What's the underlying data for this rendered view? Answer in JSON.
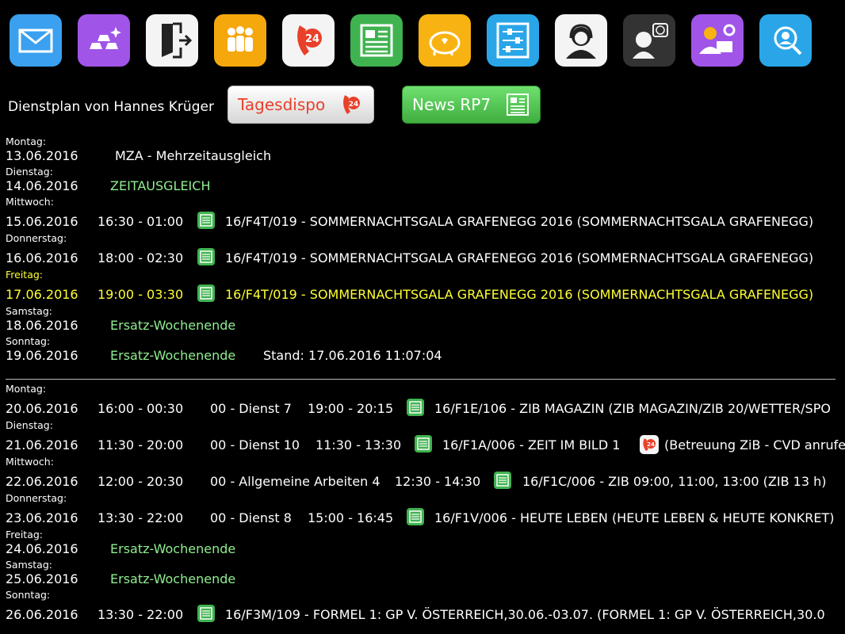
{
  "header": {
    "title": "Dienstplan von Hannes Krüger"
  },
  "buttons": {
    "tagesdispo": "Tagesdispo",
    "news": "News RP7"
  },
  "apps": [
    "mail-icon",
    "gold-bars-icon",
    "door-exit-icon",
    "people-group-icon",
    "phone-24-icon",
    "newspaper-icon",
    "piggy-bank-icon",
    "settings-sliders-icon",
    "support-headset-icon",
    "user-world-icon",
    "worker-laptop-icon",
    "user-search-icon"
  ],
  "week1": {
    "d0": {
      "weekday": "Montag:",
      "date": "13.06.2016",
      "text": "MZA - Mehrzeitausgleich"
    },
    "d1": {
      "weekday": "Dienstag:",
      "date": "14.06.2016",
      "text": "ZEITAUSGLEICH"
    },
    "d2": {
      "weekday": "Mittwoch:",
      "date": "15.06.2016",
      "time": "16:30 - 01:00",
      "text": "16/F4T/019 - SOMMERNACHTSGALA GRAFENEGG 2016 (SOMMERNACHTSGALA GRAFENEGG)"
    },
    "d3": {
      "weekday": "Donnerstag:",
      "date": "16.06.2016",
      "time": "18:00 - 02:30",
      "text": "16/F4T/019 - SOMMERNACHTSGALA GRAFENEGG 2016 (SOMMERNACHTSGALA GRAFENEGG)"
    },
    "d4": {
      "weekday": "Freitag:",
      "date": "17.06.2016",
      "time": "19:00 - 03:30",
      "text": "16/F4T/019 - SOMMERNACHTSGALA GRAFENEGG 2016 (SOMMERNACHTSGALA GRAFENEGG)"
    },
    "d5": {
      "weekday": "Samstag:",
      "date": "18.06.2016",
      "text": "Ersatz-Wochenende"
    },
    "d6": {
      "weekday": "Sonntag:",
      "date": "19.06.2016",
      "text": "Ersatz-Wochenende",
      "stand": "Stand: 17.06.2016 11:07:04"
    }
  },
  "week2": {
    "d0": {
      "weekday": "Montag:",
      "date": "20.06.2016",
      "time": "16:00 - 00:30",
      "duty": "00 - Dienst 7",
      "slot": "19:00 - 20:15",
      "text": "16/F1E/106 - ZIB MAGAZIN (ZIB MAGAZIN/ZIB 20/WETTER/SPO"
    },
    "d1": {
      "weekday": "Dienstag:",
      "date": "21.06.2016",
      "time": "11:30 - 20:00",
      "duty": "00 - Dienst 10",
      "slot": "11:30 - 13:30",
      "text": "16/F1A/006 - ZEIT IM BILD 1",
      "extra": "(Betreuung ZiB - CVD anrufen"
    },
    "d2": {
      "weekday": "Mittwoch:",
      "date": "22.06.2016",
      "time": "12:00 - 20:30",
      "duty": "00 - Allgemeine Arbeiten 4",
      "slot": "12:30 - 14:30",
      "text": "16/F1C/006 - ZIB 09:00, 11:00, 13:00 (ZIB 13 h)"
    },
    "d3": {
      "weekday": "Donnerstag:",
      "date": "23.06.2016",
      "time": "13:30 - 22:00",
      "duty": "00 - Dienst 8",
      "slot": "15:00 - 16:45",
      "text": "16/F1V/006 - HEUTE LEBEN (HEUTE LEBEN & HEUTE KONKRET)"
    },
    "d4": {
      "weekday": "Freitag:",
      "date": "24.06.2016",
      "text": "Ersatz-Wochenende"
    },
    "d5": {
      "weekday": "Samstag:",
      "date": "25.06.2016",
      "text": "Ersatz-Wochenende"
    },
    "d6": {
      "weekday": "Sonntag:",
      "date": "26.06.2016",
      "time": "13:30 - 22:00",
      "text": "16/F3M/109 - FORMEL 1: GP V. ÖSTERREICH,30.06.-03.07. (FORMEL 1: GP V. ÖSTERREICH,30.0"
    }
  }
}
